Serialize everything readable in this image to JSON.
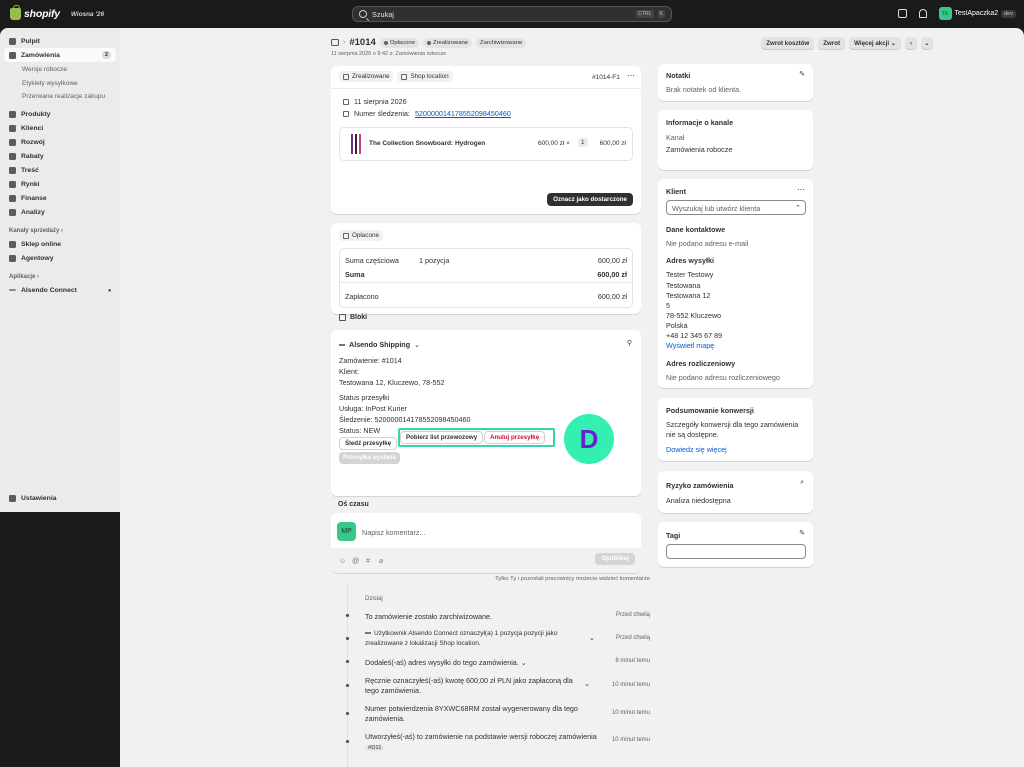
{
  "topbar": {
    "brand": "shopify",
    "season": "Wiosna '26",
    "search_placeholder": "Szukaj",
    "shortcut_ctrl": "CTRL",
    "shortcut_k": "K",
    "store_initials": "TA",
    "store_name": "TestApaczka2",
    "store_badge": "dev"
  },
  "sidebar": {
    "items": [
      {
        "label": "Pulpit",
        "icon": "home-icon"
      },
      {
        "label": "Zamówienia",
        "icon": "inbox-icon",
        "badge": "2"
      },
      {
        "label": "Produkty",
        "icon": "tag-icon"
      },
      {
        "label": "Klienci",
        "icon": "person-icon"
      },
      {
        "label": "Rozwój",
        "icon": "target-icon"
      },
      {
        "label": "Rabaty",
        "icon": "discount-icon"
      },
      {
        "label": "Treść",
        "icon": "content-icon"
      },
      {
        "label": "Rynki",
        "icon": "globe-icon"
      },
      {
        "label": "Finanse",
        "icon": "bank-icon"
      },
      {
        "label": "Analizy",
        "icon": "chart-icon"
      }
    ],
    "sub_items": [
      "Wersje robocze",
      "Etykiety wysyłkowe",
      "Przerwane realizacje zakupu"
    ],
    "sales_channels_label": "Kanały sprzedaży",
    "channels": [
      "Sklep online",
      "Agentowy"
    ],
    "apps_label": "Aplikacje",
    "apps": [
      "Alsendo Connect"
    ],
    "settings": "Ustawienia"
  },
  "header": {
    "title": "#1014",
    "pills": [
      "Opłacone",
      "Zrealizowane",
      "Zarchiwizowane"
    ],
    "subtitle": "11 sierpnia 2026 o 9:42 z: Zamówienia robocze",
    "buttons": {
      "refund": "Zwrot kosztów",
      "return": "Zwrot",
      "more": "Więcej akcji"
    }
  },
  "fulfillment": {
    "status": "Zrealizowane",
    "location": "Shop location",
    "code": "#1014-F1",
    "date": "11 sierpnia 2026",
    "tracking_label": "Numer śledzenia:",
    "tracking_number": "520000014178552098450460",
    "product": "The Collection Snowboard: Hydrogen",
    "price": "600,00 zł ×",
    "qty": "1",
    "total": "600,00 zł",
    "deliver_button": "Oznacz jako dostarczone"
  },
  "payment": {
    "status": "Opłacone",
    "rows": [
      {
        "label": "Suma częściowa",
        "mid": "1 pozycja",
        "value": "600,00 zł"
      },
      {
        "label": "Suma",
        "mid": "",
        "value": "600,00 zł"
      },
      {
        "label": "Zapłacono",
        "mid": "",
        "value": "600,00 zł"
      }
    ]
  },
  "blocks": {
    "heading": "Bloki",
    "app": "Alsendo Shipping",
    "lines": [
      "Zamówienie: #1014",
      "Klient:",
      "Testowana 12, Kluczewo, 78-552"
    ],
    "shipment_lines": [
      "Status przesyłki",
      "Usługa: InPost Kurier",
      "Śledzenie: 520000014178552098450460",
      "Status: NEW"
    ],
    "track_button": "Śledź przesyłkę",
    "label_button": "Pobierz list przewozowy",
    "cancel_button": "Anuluj przesyłkę",
    "send_button": "Przesyłka wysłana",
    "badge": "D"
  },
  "timeline": {
    "heading": "Oś czasu",
    "avatar": "MP",
    "placeholder": "Napisz komentarz...",
    "post": "Opublikuj",
    "note": "Tylko Ty i pozostali pracownicy możecie widzieć komentarze",
    "day": "Dzisiaj",
    "events": [
      {
        "text": "To zamówienie zostało zarchiwizowane.",
        "time": "Przed chwilą"
      },
      {
        "text": "Użytkownik Alsendo Connect oznaczył(a) 1 pozycja pozycji jako zrealizowane z lokalizacji Shop location.",
        "time": "Przed chwilą"
      },
      {
        "text": "Dodałeś(-aś) adres wysyłki do tego zamówienia.",
        "time": "8 minut temu"
      },
      {
        "text": "Ręcznie oznaczyłeś(-aś) kwotę 600,00 zł PLN jako zapłaconą dla tego zamówienia.",
        "time": "10 minut temu"
      },
      {
        "text": "Numer potwierdzenia 8YXWC68RM został wygenerowany dla tego zamówienia.",
        "time": "10 minut temu"
      },
      {
        "text": "Utworzyłeś(-aś) to zamówienie na podstawie wersji roboczej zamówienia",
        "tag": "#D11",
        "time": "10 minut temu"
      }
    ]
  },
  "notes": {
    "title": "Notatki",
    "text": "Brak notatek od klienta."
  },
  "channel": {
    "title": "Informacje o kanale",
    "label": "Kanał",
    "value": "Zamówienia robocze"
  },
  "customer": {
    "title": "Klient",
    "search_placeholder": "Wyszukaj lub utwórz klienta",
    "contact_title": "Dane kontaktowe",
    "contact_text": "Nie podano adresu e-mail",
    "shipping_title": "Adres wysyłki",
    "address": [
      "Tester Testowy",
      "Testowana",
      "Testowana 12",
      "5",
      "78-552 Kluczewo",
      "Polska",
      "+48 12 345 67 89"
    ],
    "map_link": "Wyświetl mapę",
    "billing_title": "Adres rozliczeniowy",
    "billing_text": "Nie podano adresu rozliczeniowego"
  },
  "conversion": {
    "title": "Podsumowanie konwersji",
    "text": "Szczegóły konwersji dla tego zamówienia nie są dostępne.",
    "link": "Dowiedz się więcej"
  },
  "risk": {
    "title": "Ryzyko zamówienia",
    "text": "Analiza niedostępna"
  },
  "tags": {
    "title": "Tagi"
  }
}
